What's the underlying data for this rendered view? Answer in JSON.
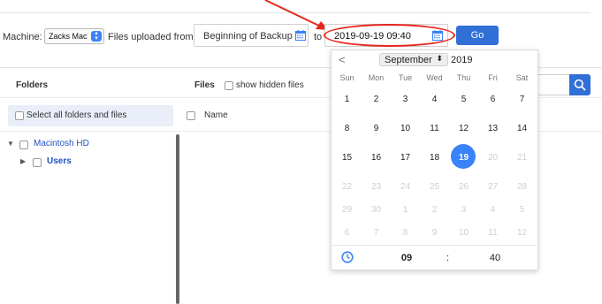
{
  "toolbar": {
    "machine_label": "Machine:",
    "machine_value": "Zacks Mac",
    "from_label": "Files uploaded from:",
    "from_value": "Beginning of Backup",
    "to_label": "to",
    "to_value": "2019-09-19 09:40",
    "go_label": "Go"
  },
  "panel": {
    "folders_heading": "Folders",
    "files_heading": "Files",
    "show_hidden_label": "show hidden files",
    "select_all_label": "Select all folders and files",
    "name_column": "Name"
  },
  "tree": {
    "root_label": "Macintosh HD",
    "child_label": "Users"
  },
  "calendar": {
    "prev_symbol": "<",
    "month": "September",
    "year": "2019",
    "weekdays": [
      "Sun",
      "Mon",
      "Tue",
      "Wed",
      "Thu",
      "Fri",
      "Sat"
    ],
    "days": [
      [
        "1",
        "2",
        "3",
        "4",
        "5",
        "6",
        "7"
      ],
      [
        "8",
        "9",
        "10",
        "11",
        "12",
        "13",
        "14"
      ],
      [
        "15",
        "16",
        "17",
        "18",
        "19",
        "20",
        "21"
      ],
      [
        "22",
        "23",
        "24",
        "25",
        "26",
        "27",
        "28"
      ],
      [
        "29",
        "30",
        "1",
        "2",
        "3",
        "4",
        "5"
      ],
      [
        "6",
        "7",
        "8",
        "9",
        "10",
        "11",
        "12"
      ]
    ],
    "selected_day": "19",
    "hour": "09",
    "separator": ":",
    "minute": "40"
  },
  "colors": {
    "accent": "#2f6fd6",
    "selected": "#3a82f7",
    "annotation": "#e8271f"
  }
}
